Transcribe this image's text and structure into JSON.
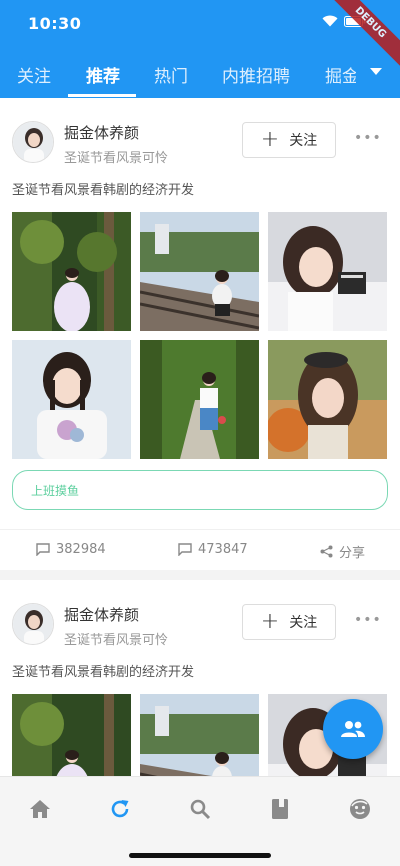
{
  "status_bar": {
    "time": "10:30",
    "debug_label": "DEBUG"
  },
  "tabs": [
    {
      "label": "关注",
      "active": false
    },
    {
      "label": "推荐",
      "active": true
    },
    {
      "label": "热门",
      "active": false
    },
    {
      "label": "内推招聘",
      "active": false
    },
    {
      "label": "掘金",
      "active": false
    }
  ],
  "posts": [
    {
      "username": "掘金体养颜",
      "signature": "圣诞节看风景可怜",
      "follow_label": "关注",
      "text": "圣诞节看风景看韩剧的经济开发",
      "tag": "上班摸鱼",
      "comments": "382984",
      "likes": "473847",
      "share_label": "分享"
    },
    {
      "username": "掘金体养颜",
      "signature": "圣诞节看风景可怜",
      "follow_label": "关注",
      "text": "圣诞节看风景看韩剧的经济开发"
    }
  ],
  "bottom_nav": [
    {
      "icon": "home-icon"
    },
    {
      "icon": "refresh-icon",
      "active": true
    },
    {
      "icon": "search-icon"
    },
    {
      "icon": "book-icon"
    },
    {
      "icon": "profile-face-icon"
    }
  ],
  "colors": {
    "primary": "#2196f3",
    "tag": "#5ccf9e",
    "nav_inactive": "#8a8a8a"
  }
}
